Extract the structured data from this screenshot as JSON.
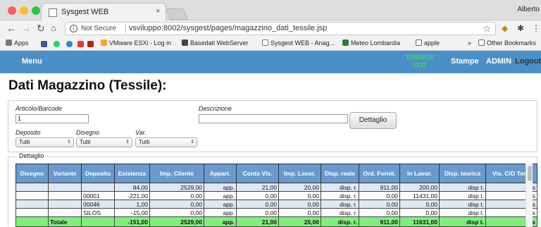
{
  "browser": {
    "tab_title": "Sysgest WEB",
    "tab_close": "×",
    "user": "Alberto",
    "not_secure": "Not Secure",
    "url": "vsviluppo:8002/sysgest/pages/magazzino_dati_tessile.jsp",
    "bookmarks": [
      "Apps",
      "VMware ESXi - Log in",
      "Basedati WebServer",
      "Sysgest WEB - Anag...",
      "Meteo Lombardia",
      "apple",
      "Other Bookmarks"
    ],
    "overflow": "»"
  },
  "app": {
    "menu": "Menu",
    "date": "17/01/2018",
    "time": "13:25",
    "stampe": "Stampe",
    "admin": "ADMIN",
    "logout": "Logout"
  },
  "page": {
    "title": "Dati Magazzino (Tessile):"
  },
  "form": {
    "articolo_label": "Articolo/Barcode",
    "articolo_value": "1",
    "descrizione_label": "Descrizione",
    "descrizione_value": "",
    "dettaglio_button": "Dettaglio",
    "deposito_label": "Deposito",
    "deposito_value": "Tutti",
    "disegno_label": "Disegno",
    "disegno_value": "Tutti",
    "var_label": "Var.",
    "var_value": "Tutti"
  },
  "detail": {
    "section_title": "Dettaglio",
    "columns": [
      "Disegno",
      "Variante",
      "Deposito",
      "Esistenza",
      "Imp. Cliente",
      "Appart.",
      "Conto Vis.",
      "Imp. Lavor.",
      "Disp. reale",
      "Ord. Fornit.",
      "In Lavor.",
      "Disp. teorica",
      "Vis. C/O Terzi"
    ],
    "rows": [
      [
        "",
        "",
        "",
        "84,00",
        "2529,00",
        "app.",
        "21,00",
        "20,00",
        "disp. r.",
        "911,00",
        "200,00",
        "disp t.",
        "vis"
      ],
      [
        "",
        "",
        "00001",
        "-221,00",
        "0,00",
        "app.",
        "0,00",
        "0,00",
        "disp. r.",
        "0,00",
        "11431,00",
        "disp t.",
        "vis"
      ],
      [
        "",
        "",
        "00046",
        "1,00",
        "0,00",
        "app.",
        "0,00",
        "0,00",
        "disp. r.",
        "0,00",
        "0,00",
        "disp t.",
        "vis"
      ],
      [
        "",
        "",
        "SILOS",
        "-15,00",
        "0,00",
        "app.",
        "0,00",
        "0,00",
        "disp. r.",
        "0,00",
        "0,00",
        "disp t.",
        "vis"
      ],
      [
        "",
        "Totale",
        "",
        "-151,00",
        "2529,00",
        "app.",
        "21,00",
        "20,00",
        "disp. r.",
        "911,00",
        "11631,00",
        "disp t.",
        "vis"
      ]
    ]
  },
  "colors": {
    "app_bar": "#4a90c6",
    "header": "#6a9acd",
    "total_row": "#7ef07a",
    "clock": "#3aff3a"
  }
}
